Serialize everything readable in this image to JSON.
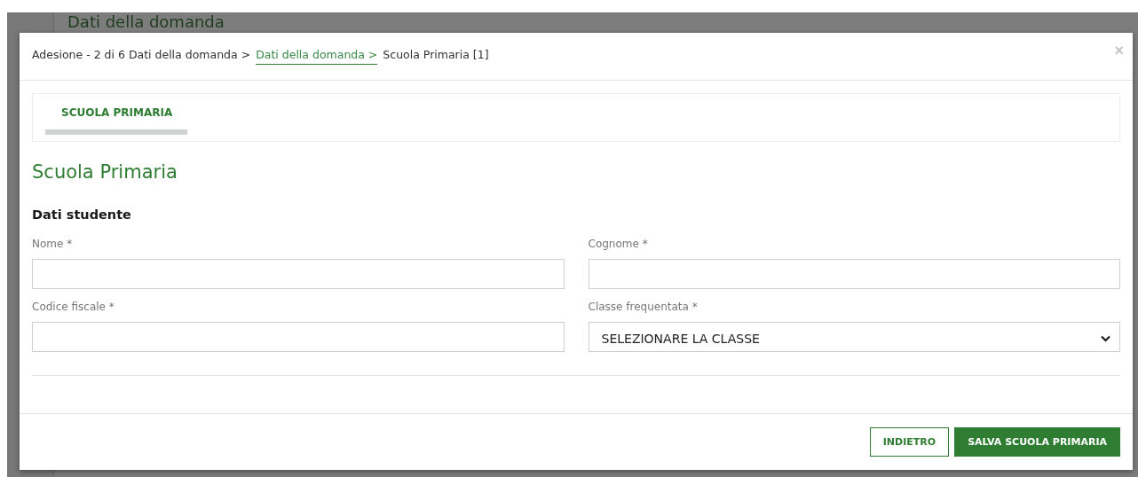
{
  "background_page": {
    "heading": "Dati della domanda"
  },
  "modal": {
    "breadcrumb": [
      {
        "label": "Adesione - 2 di 6 Dati della domanda >",
        "kind": "text"
      },
      {
        "label": "Dati della domanda >",
        "kind": "link"
      },
      {
        "label": "Scuola Primaria [1]",
        "kind": "text"
      }
    ],
    "close": "×",
    "tabs": [
      {
        "label": "SCUOLA PRIMARIA",
        "selected": true
      }
    ],
    "title": "Scuola Primaria",
    "section": "Dati studente",
    "fields": [
      {
        "label": "Nome *",
        "kind": "text"
      },
      {
        "label": "Cognome *",
        "kind": "text"
      },
      {
        "label": "Codice fiscale *",
        "kind": "text"
      },
      {
        "label": "Classe frequentata *",
        "kind": "select",
        "value": "SELEZIONARE LA CLASSE"
      }
    ],
    "buttons": [
      {
        "label": "INDIETRO",
        "kind": "secondary"
      },
      {
        "label": "SALVA SCUOLA PRIMARIA",
        "kind": "primary"
      }
    ]
  }
}
